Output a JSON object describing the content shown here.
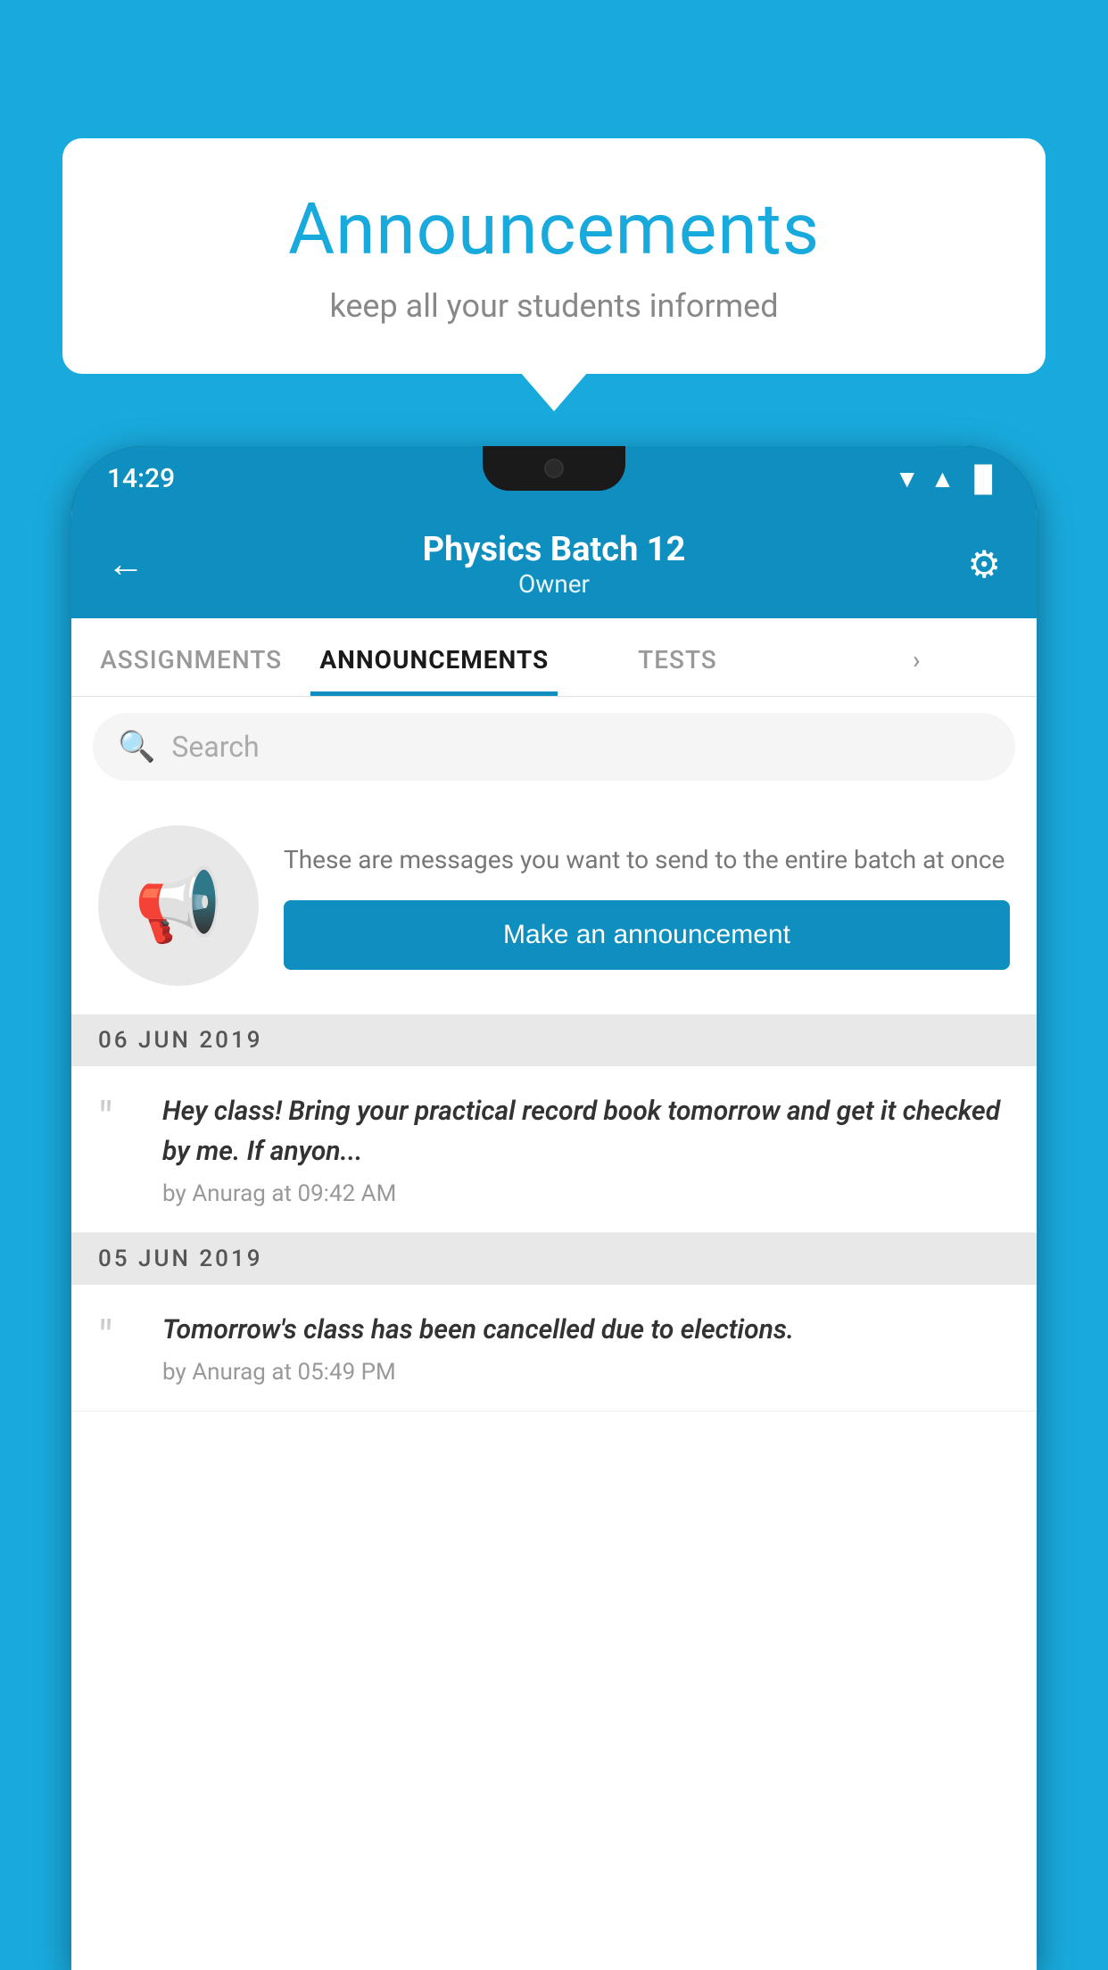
{
  "background_color": "#19AADD",
  "speech_bubble": {
    "title": "Announcements",
    "subtitle": "keep all your students informed"
  },
  "status_bar": {
    "time": "14:29",
    "wifi_icon": "▲",
    "signal_icon": "▲",
    "battery_icon": "▐"
  },
  "header": {
    "back_label": "←",
    "title": "Physics Batch 12",
    "subtitle": "Owner",
    "gear_icon": "⚙"
  },
  "tabs": [
    {
      "label": "ASSIGNMENTS",
      "active": false
    },
    {
      "label": "ANNOUNCEMENTS",
      "active": true
    },
    {
      "label": "TESTS",
      "active": false
    },
    {
      "label": "›",
      "active": false
    }
  ],
  "search": {
    "placeholder": "Search",
    "icon": "🔍"
  },
  "promo": {
    "description": "These are messages you want to send to the entire batch at once",
    "button_label": "Make an announcement"
  },
  "announcements": [
    {
      "date": "06  JUN  2019",
      "text": "Hey class! Bring your practical record book tomorrow and get it checked by me. If anyon...",
      "meta": "by Anurag at 09:42 AM"
    },
    {
      "date": "05  JUN  2019",
      "text": "Tomorrow's class has been cancelled due to elections.",
      "meta": "by Anurag at 05:49 PM"
    }
  ]
}
